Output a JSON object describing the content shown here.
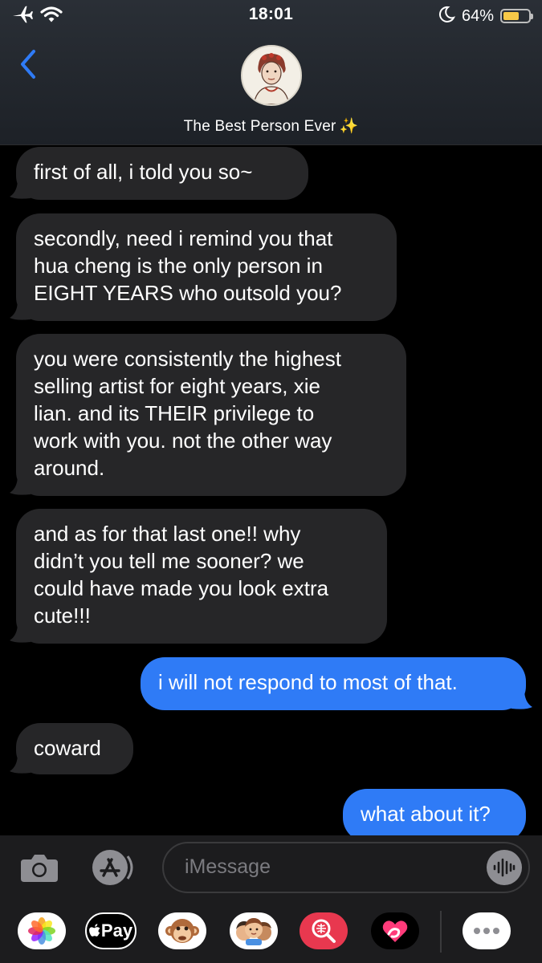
{
  "status_bar": {
    "time": "18:01",
    "battery_percent": "64%",
    "battery_level": 0.64,
    "icons": [
      "airplane-icon",
      "wifi-icon",
      "moon-icon",
      "battery-icon"
    ]
  },
  "header": {
    "contact_name": "The Best Person Ever",
    "contact_emoji": "✨",
    "icons": [
      "chevron-left-icon",
      "avatar"
    ]
  },
  "messages": [
    {
      "direction": "incoming",
      "lines": [
        "first of all, i told you so~"
      ]
    },
    {
      "direction": "incoming",
      "lines": [
        "secondly, need i remind you that",
        "hua cheng is the only person in",
        "EIGHT YEARS who outsold you?"
      ]
    },
    {
      "direction": "incoming",
      "lines": [
        "you were consistently the highest",
        "selling artist for eight years, xie",
        "lian. and its THEIR privilege to",
        "work with you. not the other way",
        "around."
      ]
    },
    {
      "direction": "incoming",
      "lines": [
        "and as for that last one!! why",
        "didn’t you tell me sooner? we",
        "could have made you look extra",
        "cute!!!"
      ]
    },
    {
      "direction": "outgoing",
      "lines": [
        "i will not respond to most of that."
      ]
    },
    {
      "direction": "incoming",
      "lines": [
        "coward"
      ]
    },
    {
      "direction": "outgoing",
      "lines": [
        "what about it?"
      ]
    }
  ],
  "input": {
    "placeholder": "iMessage",
    "icons": [
      "camera-icon",
      "app-store-icon",
      "waveform-icon"
    ]
  },
  "app_drawer": {
    "apple_pay_label": "Pay",
    "apps": [
      "photos-app-icon",
      "apple-pay-icon",
      "animoji-monkey-icon",
      "memoji-stickers-icon",
      "image-search-icon",
      "digital-touch-icon",
      "more-apps-icon"
    ]
  },
  "colors": {
    "incoming_bubble": "#262628",
    "outgoing_bubble": "#2f7bf6",
    "accent_blue": "#2f7bf6"
  }
}
